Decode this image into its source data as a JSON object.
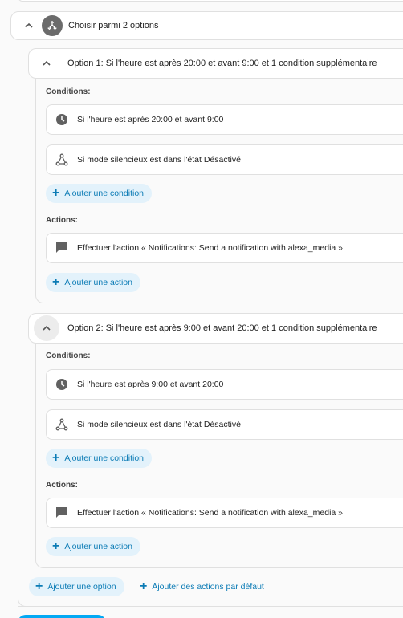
{
  "choose": {
    "title": "Choisir parmi 2 options",
    "icon": "arrow-decision-icon"
  },
  "options": [
    {
      "title": "Option 1: Si l'heure est après 20:00 et avant 9:00 et 1 condition supplémentaire",
      "conditions_label": "Conditions:",
      "conditions": [
        {
          "icon": "clock-icon",
          "text": "Si l'heure est après 20:00 et avant 9:00"
        },
        {
          "icon": "state-graph-icon",
          "text": "Si mode silencieux est dans l'état Désactivé"
        }
      ],
      "add_condition": "Ajouter une condition",
      "actions_label": "Actions:",
      "actions": [
        {
          "icon": "message-icon",
          "text": "Effectuer l'action « Notifications: Send a notification with alexa_media »"
        }
      ],
      "add_action": "Ajouter une action"
    },
    {
      "title": "Option 2: Si l'heure est après 9:00 et avant 20:00 et 1 condition supplémentaire",
      "conditions_label": "Conditions:",
      "conditions": [
        {
          "icon": "clock-icon",
          "text": "Si l'heure est après 9:00 et avant 20:00"
        },
        {
          "icon": "state-graph-icon",
          "text": "Si mode silencieux est dans l'état Désactivé"
        }
      ],
      "add_condition": "Ajouter une condition",
      "actions_label": "Actions:",
      "actions": [
        {
          "icon": "message-icon",
          "text": "Effectuer l'action « Notifications: Send a notification with alexa_media »"
        }
      ],
      "add_action": "Ajouter une action"
    }
  ],
  "footer": {
    "add_option": "Ajouter une option",
    "add_default_actions": "Ajouter des actions par défaut"
  },
  "colors": {
    "accent": "#0b7bb5",
    "pill_bg": "#e3f2fb",
    "icon_grey": "#616161"
  }
}
